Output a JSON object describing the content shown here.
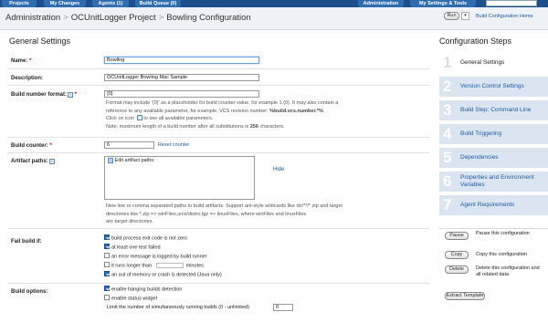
{
  "topbar": {
    "projects": "Projects",
    "my_changes": "My Changes",
    "agents": "Agents (1)",
    "build_queue": "Build Queue (0)",
    "administration": "Administration",
    "settings": "My Settings & Tools"
  },
  "breadcrumb": {
    "items": [
      "Administration",
      "OCUnitLogger Project",
      "Bowling Configuration"
    ],
    "run": "Run",
    "home_link": "Build Configuration Home"
  },
  "general": {
    "title": "General Settings",
    "name_label": "Name:",
    "name_value": "Bowling",
    "description_label": "Description:",
    "description_value": "OCUnitLogger Bowling Mac Sample",
    "build_number_label": "Build number format:",
    "build_number_value": "{0}",
    "build_number_note_1": "Format may include '{0}' as a placeholder for build counter value, for example 1.{0}. It may also contain a",
    "build_number_note_2a": "reference to any available parameter, for example, VCS revision number: ",
    "build_number_note_2b": "%build.vcs.number.*%",
    "build_number_note_3a": "Click on icon",
    "build_number_note_3b": "to see all available parameters.",
    "build_number_note_4a": "Note: maximum length of a build number after all substitutions is ",
    "build_number_note_4b": "256",
    "build_number_note_4c": " characters.",
    "counter_label": "Build counter:",
    "counter_value": "6",
    "reset_counter": "Reset counter",
    "artifact_label": "Artifact paths:",
    "edit_artifact": "Edit artifact paths:",
    "hide": "Hide",
    "artifact_note_1": "New line or comma separated paths to build artifacts. Support ant-style wildcards like dir/**/*.zip and target",
    "artifact_note_2": "directories like *.zip => winFiles,unix/distro.tgz => linuxFiles, where winFiles and linuxFiles",
    "artifact_note_3": "are target directories."
  },
  "fail": {
    "label": "Fail build if:",
    "opts": [
      {
        "text": "build process exit code is not zero",
        "checked": true
      },
      {
        "text": "at least one test failed",
        "checked": true
      },
      {
        "text": "an error message is logged by build runner",
        "checked": false
      },
      {
        "text": "it runs longer than",
        "suffix": "minutes",
        "checked": false
      },
      {
        "text": "an out of memory or crash is detected (Java only)",
        "checked": true
      }
    ]
  },
  "options": {
    "label": "Build options:",
    "hanging": "enable hanging builds detection",
    "status_widget": "enable status widget",
    "limit_text": "Limit the number of simultaneously running builds (0 - unlimited)",
    "limit_value": "0"
  },
  "steps": {
    "title": "Configuration Steps",
    "items": [
      {
        "num": "1",
        "label": "General Settings"
      },
      {
        "num": "2",
        "label": "Version Control Settings"
      },
      {
        "num": "3",
        "label": "Build Step: Command Line"
      },
      {
        "num": "4",
        "label": "Build Triggering"
      },
      {
        "num": "5",
        "label": "Dependencies"
      },
      {
        "num": "6",
        "label": "Properties and Environment Variables"
      },
      {
        "num": "7",
        "label": "Agent Requirements"
      }
    ]
  },
  "actions": {
    "pause_btn": "Pause",
    "pause_text": "Pause this configuration",
    "copy_btn": "Copy",
    "copy_text": "Copy this configuration",
    "delete_btn": "Delete",
    "delete_text": "Delete this configuration and all related data",
    "extract_btn": "Extract Template"
  }
}
